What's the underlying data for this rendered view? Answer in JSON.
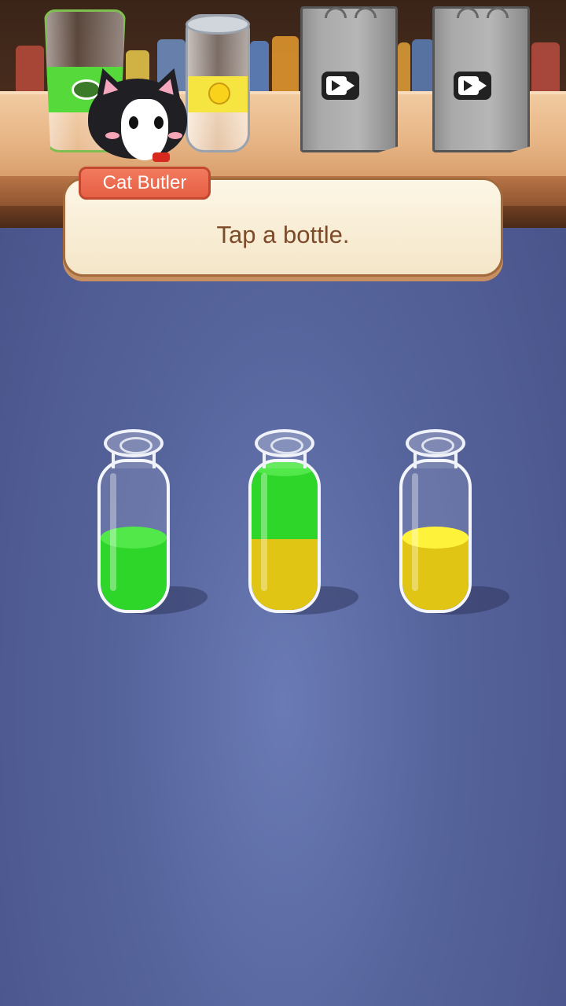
{
  "header": {
    "orders": [
      {
        "name": "matcha-glass",
        "band_color": "#56d93a"
      },
      {
        "name": "lemon-can",
        "band_color": "#f6e541"
      },
      {
        "name": "video-bag-1",
        "icon": "video-icon"
      },
      {
        "name": "video-bag-2",
        "icon": "video-icon"
      }
    ]
  },
  "dialog": {
    "speaker": "Cat Butler",
    "message": "Tap a bottle."
  },
  "colors": {
    "green": "#2ed62a",
    "green_top": "#52e84a",
    "yellow": "#e0c515",
    "yellow_top": "#fff23a"
  },
  "bottles": [
    {
      "capacity": 4,
      "layers": [
        "green",
        "green"
      ]
    },
    {
      "capacity": 4,
      "layers": [
        "yellow",
        "yellow",
        "green",
        "green"
      ]
    },
    {
      "capacity": 4,
      "layers": [
        "yellow",
        "yellow"
      ]
    }
  ]
}
